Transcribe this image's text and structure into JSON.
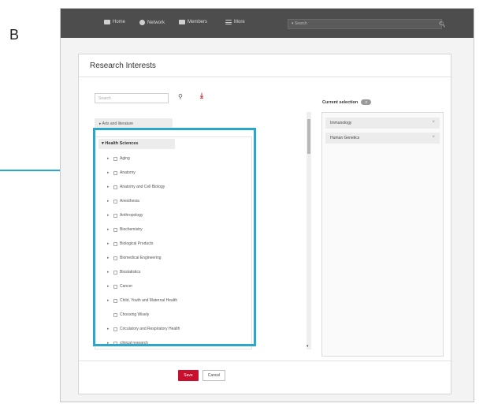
{
  "panel_letter": "B",
  "topbar": {
    "nav": [
      {
        "label": "Home",
        "icon": "home-icon"
      },
      {
        "label": "Network",
        "icon": "network-icon"
      },
      {
        "label": "Members",
        "icon": "members-icon"
      },
      {
        "label": "More",
        "icon": "menu-icon"
      }
    ],
    "search_placeholder": "▾ Search"
  },
  "dialog": {
    "title": "Research Interests",
    "search_placeholder": "Search",
    "tree": {
      "collapsed_group": "▸ Arts and literature",
      "expanded_group": "▾ Health Sciences",
      "items": [
        {
          "label": "Aging",
          "expandable": true
        },
        {
          "label": "Anatomy",
          "expandable": true
        },
        {
          "label": "Anatomy and Cell Biology",
          "expandable": true
        },
        {
          "label": "Anesthesia",
          "expandable": true
        },
        {
          "label": "Anthropology",
          "expandable": true
        },
        {
          "label": "Biochemistry",
          "expandable": true
        },
        {
          "label": "Biological Products",
          "expandable": true
        },
        {
          "label": "Biomedical Engineering",
          "expandable": true
        },
        {
          "label": "Biostatistics",
          "expandable": true
        },
        {
          "label": "Cancer",
          "expandable": true
        },
        {
          "label": "Child, Youth and Maternal Health",
          "expandable": true
        },
        {
          "label": "Choosing Wisely",
          "expandable": false
        },
        {
          "label": "Circulatory and Respiratory Health",
          "expandable": true
        },
        {
          "label": "clinical research",
          "expandable": true
        }
      ]
    },
    "current_selection": {
      "label": "Current selection",
      "count": "2",
      "items": [
        "Immunology",
        "Human Genetics"
      ]
    },
    "buttons": {
      "save": "Save",
      "cancel": "Cancel"
    }
  },
  "colors": {
    "accent_highlight": "#2aa7c9",
    "save_button": "#c8102e",
    "topbar": "#4d4d4d"
  }
}
